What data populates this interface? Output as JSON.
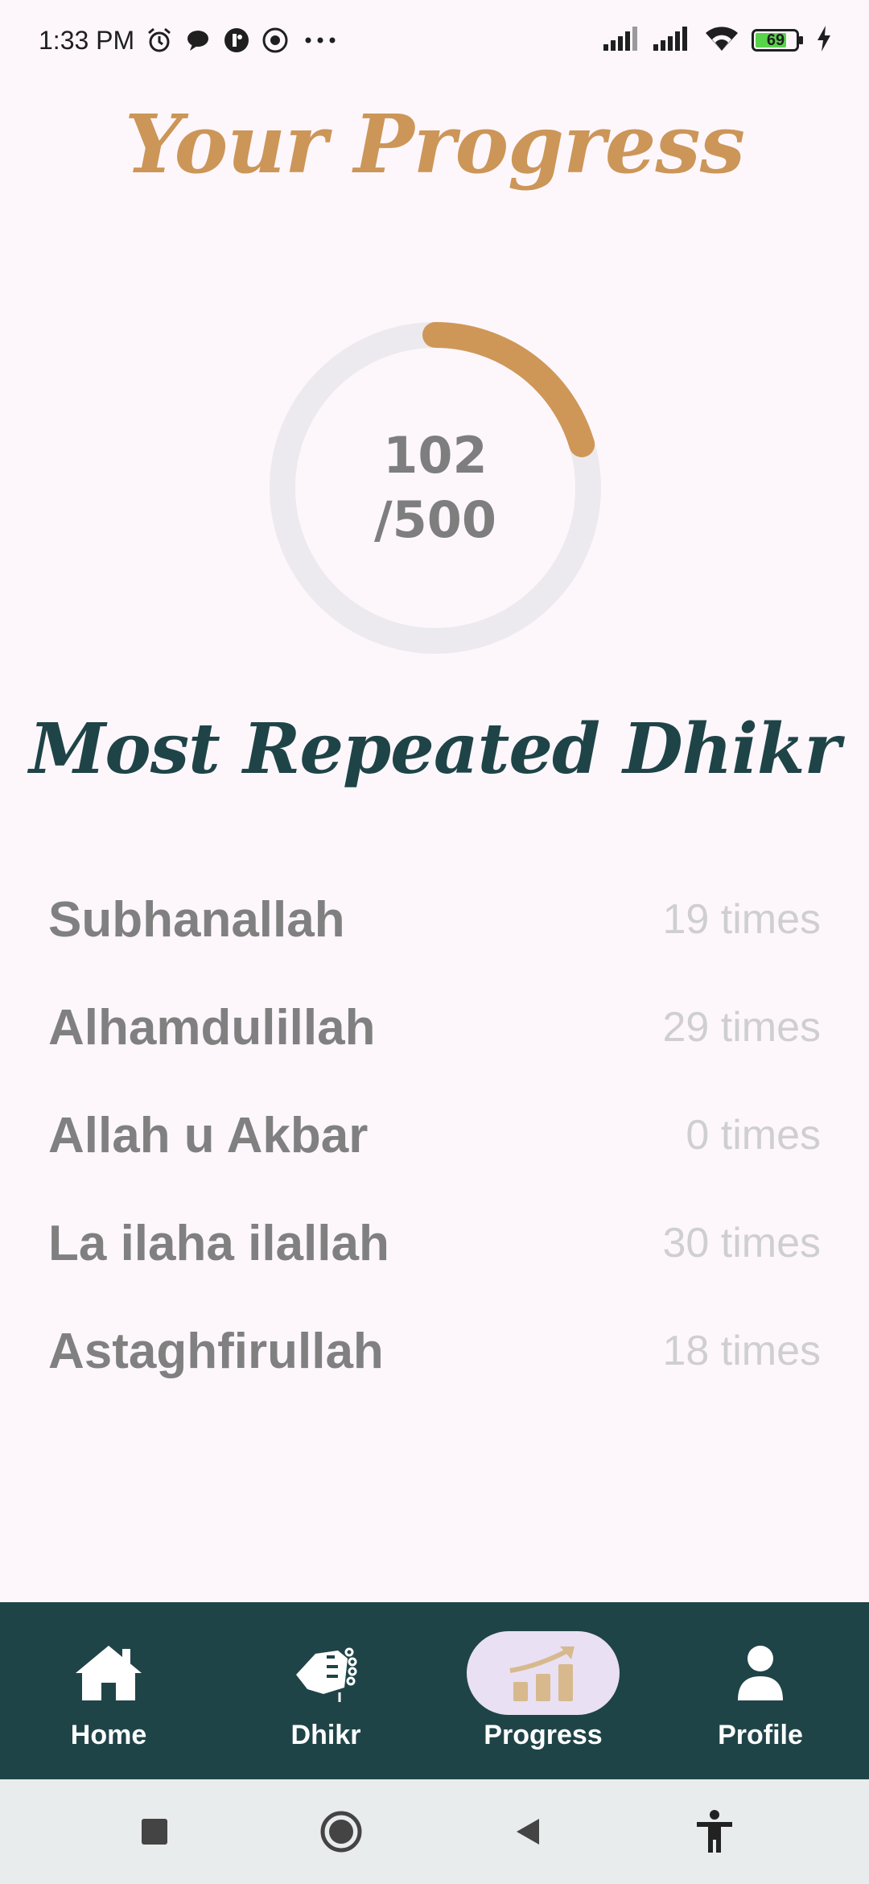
{
  "status_bar": {
    "time": "1:33 PM",
    "battery": "69"
  },
  "title": "Your Progress",
  "progress": {
    "current": "102",
    "total": "/500",
    "fraction": 0.204,
    "track_color": "#eceaee",
    "fill_color": "#cf9757"
  },
  "section_title": "Most Repeated Dhikr",
  "dhikr": [
    {
      "name": "Subhanallah",
      "count": "19 times"
    },
    {
      "name": "Alhamdulillah",
      "count": "29 times"
    },
    {
      "name": "Allah u Akbar",
      "count": "0 times"
    },
    {
      "name": "La ilaha ilallah",
      "count": "30 times"
    },
    {
      "name": "Astaghfirullah",
      "count": "18 times"
    }
  ],
  "nav": {
    "home": "Home",
    "dhikr": "Dhikr",
    "progress": "Progress",
    "profile": "Profile"
  },
  "colors": {
    "accent": "#cc9658",
    "nav_bg": "#1f4448",
    "nav_active_pill": "#e9e0f3"
  }
}
